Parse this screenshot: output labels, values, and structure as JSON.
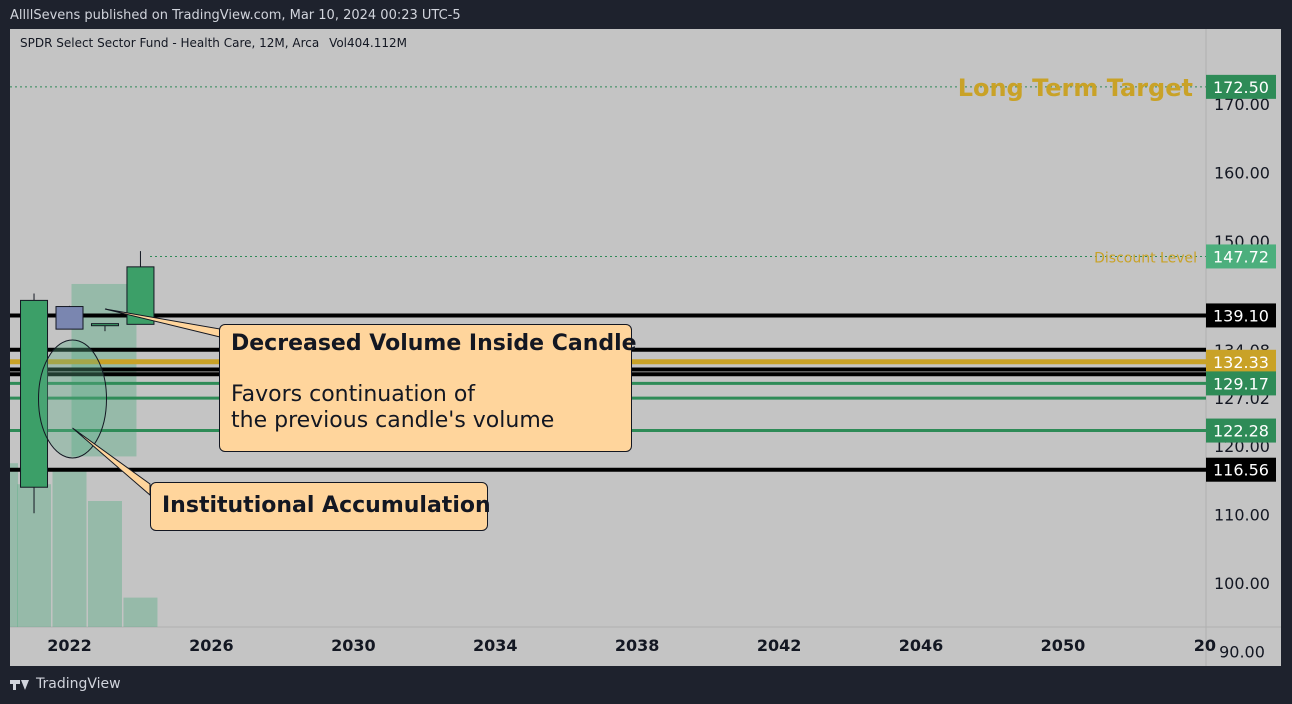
{
  "header": {
    "publish_line": "AllllSevens published on TradingView.com, Mar 10, 2024 00:23 UTC-5"
  },
  "footer": {
    "brand": "TradingView"
  },
  "legend": {
    "symbol_line": "SPDR Select Sector Fund - Health Care, 12M, Arca",
    "volume_label": "Vol",
    "volume_value": "404.112M"
  },
  "annotations": {
    "long_term_target": "Long Term Target",
    "discount_level": "Discount Level",
    "callout_volume_title": "Decreased Volume Inside Candle",
    "callout_volume_line1": "Favors continuation of",
    "callout_volume_line2": "the previous candle's volume",
    "callout_institutional": "Institutional Accumulation"
  },
  "colors": {
    "background": "#c4c4c4",
    "bull_candle": "#3c9f68",
    "inside_candle": "#7a86b0",
    "gold": "#c9a227",
    "green_tag": "#2e8b57",
    "black_line": "#000000",
    "green_line": "#2e8b57"
  },
  "chart_data": {
    "type": "candlestick",
    "y_axis": {
      "ticks": [
        "170.00",
        "160.00",
        "150.00",
        "134.08",
        "127.02",
        "120.00",
        "110.00",
        "100.00",
        "90.00"
      ],
      "ylim": [
        90,
        171.5
      ]
    },
    "x_axis": {
      "ticks": [
        "2022",
        "2026",
        "2030",
        "2034",
        "2038",
        "2042",
        "2046",
        "2050",
        "20"
      ]
    },
    "candles": [
      {
        "year": 2021,
        "open": 114,
        "high": 142.3,
        "low": 110.2,
        "close": 141.3,
        "kind": "bull"
      },
      {
        "year": 2022,
        "open": 137.1,
        "high": 140.5,
        "low": 137.1,
        "close": 140.4,
        "kind": "inside"
      },
      {
        "year": 2023,
        "open": 137.6,
        "high": 137.9,
        "low": 136.8,
        "close": 137.9,
        "kind": "doji"
      },
      {
        "year": 2024,
        "open": 137.8,
        "high": 148.5,
        "low": 137.8,
        "close": 146.2,
        "kind": "bull"
      }
    ],
    "volume_bars": [
      {
        "year": 2020.8,
        "rel": 0.78
      },
      {
        "year": 2021,
        "rel": 0.68
      },
      {
        "year": 2022,
        "rel": 0.75
      },
      {
        "year": 2023,
        "rel": 0.6
      },
      {
        "year": 2024,
        "rel": 0.14
      }
    ],
    "shaded_zones": [
      {
        "x_start": 2022,
        "x_end": 2024,
        "y_low": 118.5,
        "y_high": 143.7
      }
    ],
    "price_levels": [
      {
        "value": 172.5,
        "label": "172.50",
        "style": "dotted",
        "color": "#2e8b57",
        "tag_bg": "#2e8b57"
      },
      {
        "value": 147.72,
        "label": "147.72",
        "style": "dotted",
        "color": "#2e8b57",
        "tag_bg": "#4caf7d"
      },
      {
        "value": 139.1,
        "label": "139.10",
        "style": "solid",
        "color": "#000000",
        "tag_bg": "#000000"
      },
      {
        "value": 134.08,
        "label": "",
        "style": "solid",
        "color": "#000000",
        "tag_bg": ""
      },
      {
        "value": 132.33,
        "label": "132.33",
        "style": "solid",
        "color": "#c9a227",
        "tag_bg": "#c9a227"
      },
      {
        "value": 131.2,
        "label": "",
        "style": "solid",
        "color": "#000000",
        "tag_bg": ""
      },
      {
        "value": 130.5,
        "label": "",
        "style": "solid",
        "color": "#000000",
        "tag_bg": ""
      },
      {
        "value": 129.17,
        "label": "129.17",
        "style": "solid",
        "color": "#2e8b57",
        "tag_bg": "#2e8b57"
      },
      {
        "value": 127.02,
        "label": "",
        "style": "solid",
        "color": "#2e8b57",
        "tag_bg": ""
      },
      {
        "value": 122.28,
        "label": "122.28",
        "style": "solid",
        "color": "#2e8b57",
        "tag_bg": "#2e8b57"
      },
      {
        "value": 116.56,
        "label": "116.56",
        "style": "solid",
        "color": "#000000",
        "tag_bg": "#000000"
      }
    ]
  }
}
